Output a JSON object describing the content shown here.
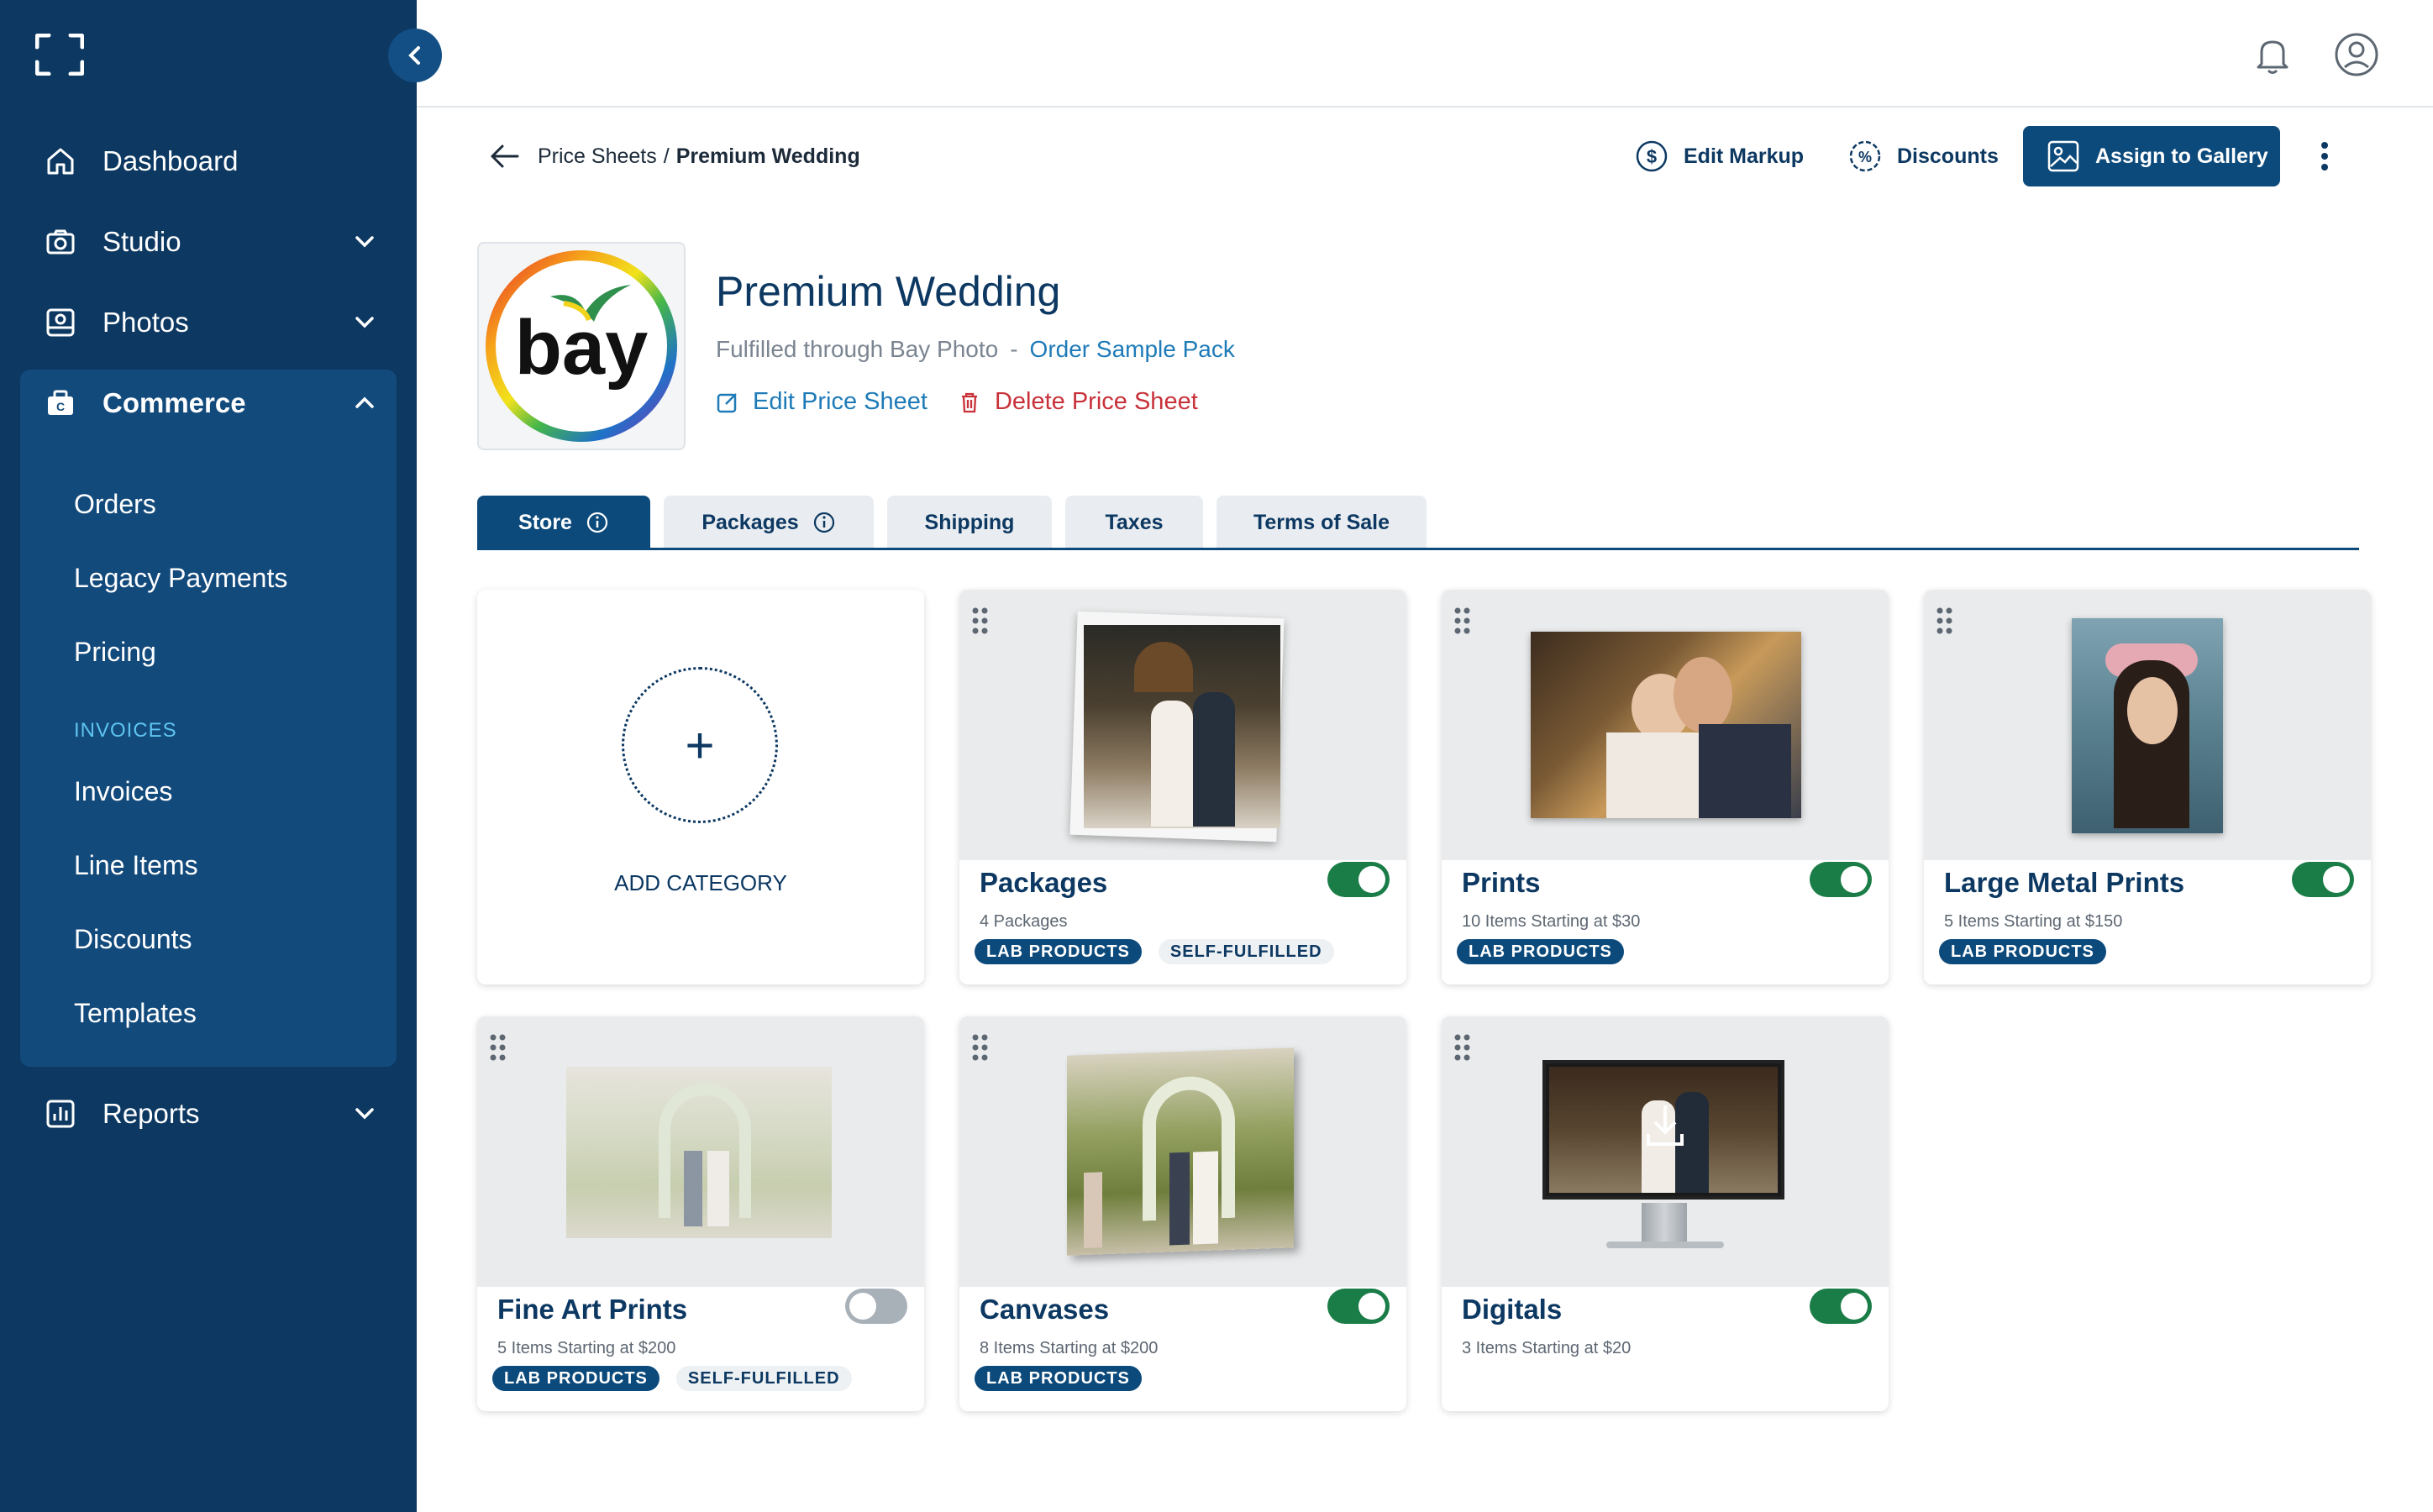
{
  "sidebar": {
    "brand_icon": "fullscreen-brackets-icon",
    "items": [
      {
        "label": "Dashboard",
        "icon": "home-icon"
      },
      {
        "label": "Studio",
        "icon": "camera-icon"
      },
      {
        "label": "Photos",
        "icon": "photos-icon"
      },
      {
        "label": "Commerce",
        "icon": "commerce-icon"
      },
      {
        "label": "Reports",
        "icon": "reports-icon"
      }
    ],
    "commerce_sub": [
      "Orders",
      "Legacy Payments",
      "Pricing"
    ],
    "invoices_section": "INVOICES",
    "invoices_sub": [
      "Invoices",
      "Line Items",
      "Discounts",
      "Templates"
    ]
  },
  "topbar": {
    "icons": [
      "bell-icon",
      "user-icon"
    ]
  },
  "breadcrumb": {
    "parent": "Price Sheets",
    "separator": "/",
    "current": "Premium Wedding"
  },
  "actions": {
    "edit_markup": "Edit Markup",
    "discounts": "Discounts",
    "assign": "Assign to Gallery"
  },
  "header": {
    "logo_text": "bay",
    "title": "Premium Wedding",
    "fulfilled": "Fulfilled through Bay Photo",
    "dash": "-",
    "order_sample": "Order Sample Pack",
    "edit_sheet": "Edit Price Sheet",
    "delete_sheet": "Delete Price Sheet"
  },
  "tabs": [
    "Store",
    "Packages",
    "Shipping",
    "Taxes",
    "Terms of Sale"
  ],
  "add_category": {
    "symbol": "+",
    "label": "ADD CATEGORY"
  },
  "categories": [
    {
      "name": "Packages",
      "meta": "4 Packages",
      "tags": [
        "LAB PRODUCTS",
        "SELF-FULFILLED"
      ],
      "enabled": true
    },
    {
      "name": "Prints",
      "meta": "10 Items Starting at $30",
      "tags": [
        "LAB PRODUCTS"
      ],
      "enabled": true
    },
    {
      "name": "Large Metal Prints",
      "meta": "5 Items Starting at $150",
      "tags": [
        "LAB PRODUCTS"
      ],
      "enabled": true
    },
    {
      "name": "Fine Art Prints",
      "meta": "5 Items Starting at $200",
      "tags": [
        "LAB PRODUCTS",
        "SELF-FULFILLED"
      ],
      "enabled": false
    },
    {
      "name": "Canvases",
      "meta": "8 Items Starting at $200",
      "tags": [
        "LAB PRODUCTS"
      ],
      "enabled": true
    },
    {
      "name": "Digitals",
      "meta": "3 Items Starting at $20",
      "tags": [],
      "enabled": true
    }
  ],
  "colors": {
    "sidebar": "#0c3862",
    "accent": "#0c4a7c",
    "toggle_on": "#1a7d47",
    "danger": "#c8313a",
    "link": "#1e7bb8"
  }
}
